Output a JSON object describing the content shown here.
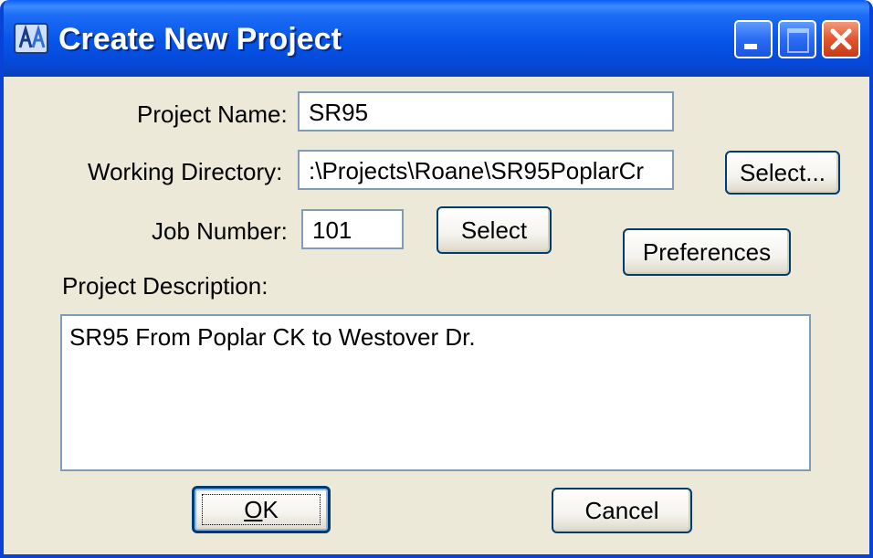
{
  "window": {
    "title": "Create New Project",
    "icon": "app-logo-icon",
    "controls": [
      "minimize-icon",
      "maximize-icon",
      "close-icon"
    ]
  },
  "form": {
    "project_name_label": "Project Name:",
    "project_name_value": "SR95",
    "working_directory_label": "Working Directory:",
    "working_directory_value": ":\\Projects\\Roane\\SR95PoplarCr",
    "working_directory_select_label": "Select...",
    "job_number_label": "Job Number:",
    "job_number_value": "101",
    "job_number_select_label": "Select",
    "preferences_label": "Preferences",
    "project_description_label": "Project Description:",
    "project_description_value": "SR95 From Poplar CK to Westover Dr."
  },
  "buttons": {
    "ok_mnemonic": "O",
    "ok_rest": "K",
    "cancel_label": "Cancel"
  },
  "colors": {
    "titlebar": "#0654e8",
    "window_face": "#ece9d8",
    "field_border": "#7f9db9",
    "button_border": "#003c74",
    "close_button": "#e2562f"
  }
}
